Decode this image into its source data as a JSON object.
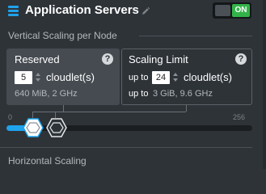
{
  "header": {
    "title": "Application Servers",
    "toggle_label": "ON",
    "toggle_on_color": "#33b34a",
    "icons": [
      "stack-icon",
      "pencil-icon"
    ]
  },
  "vertical": {
    "section_label": "Vertical Scaling per Node",
    "reserved": {
      "title": "Reserved",
      "help": "?",
      "value": "5",
      "unit": "cloudlet(s)",
      "detail": "640 MiB, 2 GHz"
    },
    "limit": {
      "title": "Scaling Limit",
      "help": "?",
      "prefix": "up to",
      "value": "24",
      "unit": "cloudlet(s)",
      "detail_prefix": "up to",
      "detail": "3 GiB, 9.6 GHz"
    },
    "slider": {
      "min_label": "0",
      "max_label": "256",
      "min": 0,
      "max": 256,
      "reserved_value": 5,
      "limit_value": 24,
      "accent": "#1fa3ec"
    }
  },
  "horizontal": {
    "section_label": "Horizontal Scaling"
  }
}
